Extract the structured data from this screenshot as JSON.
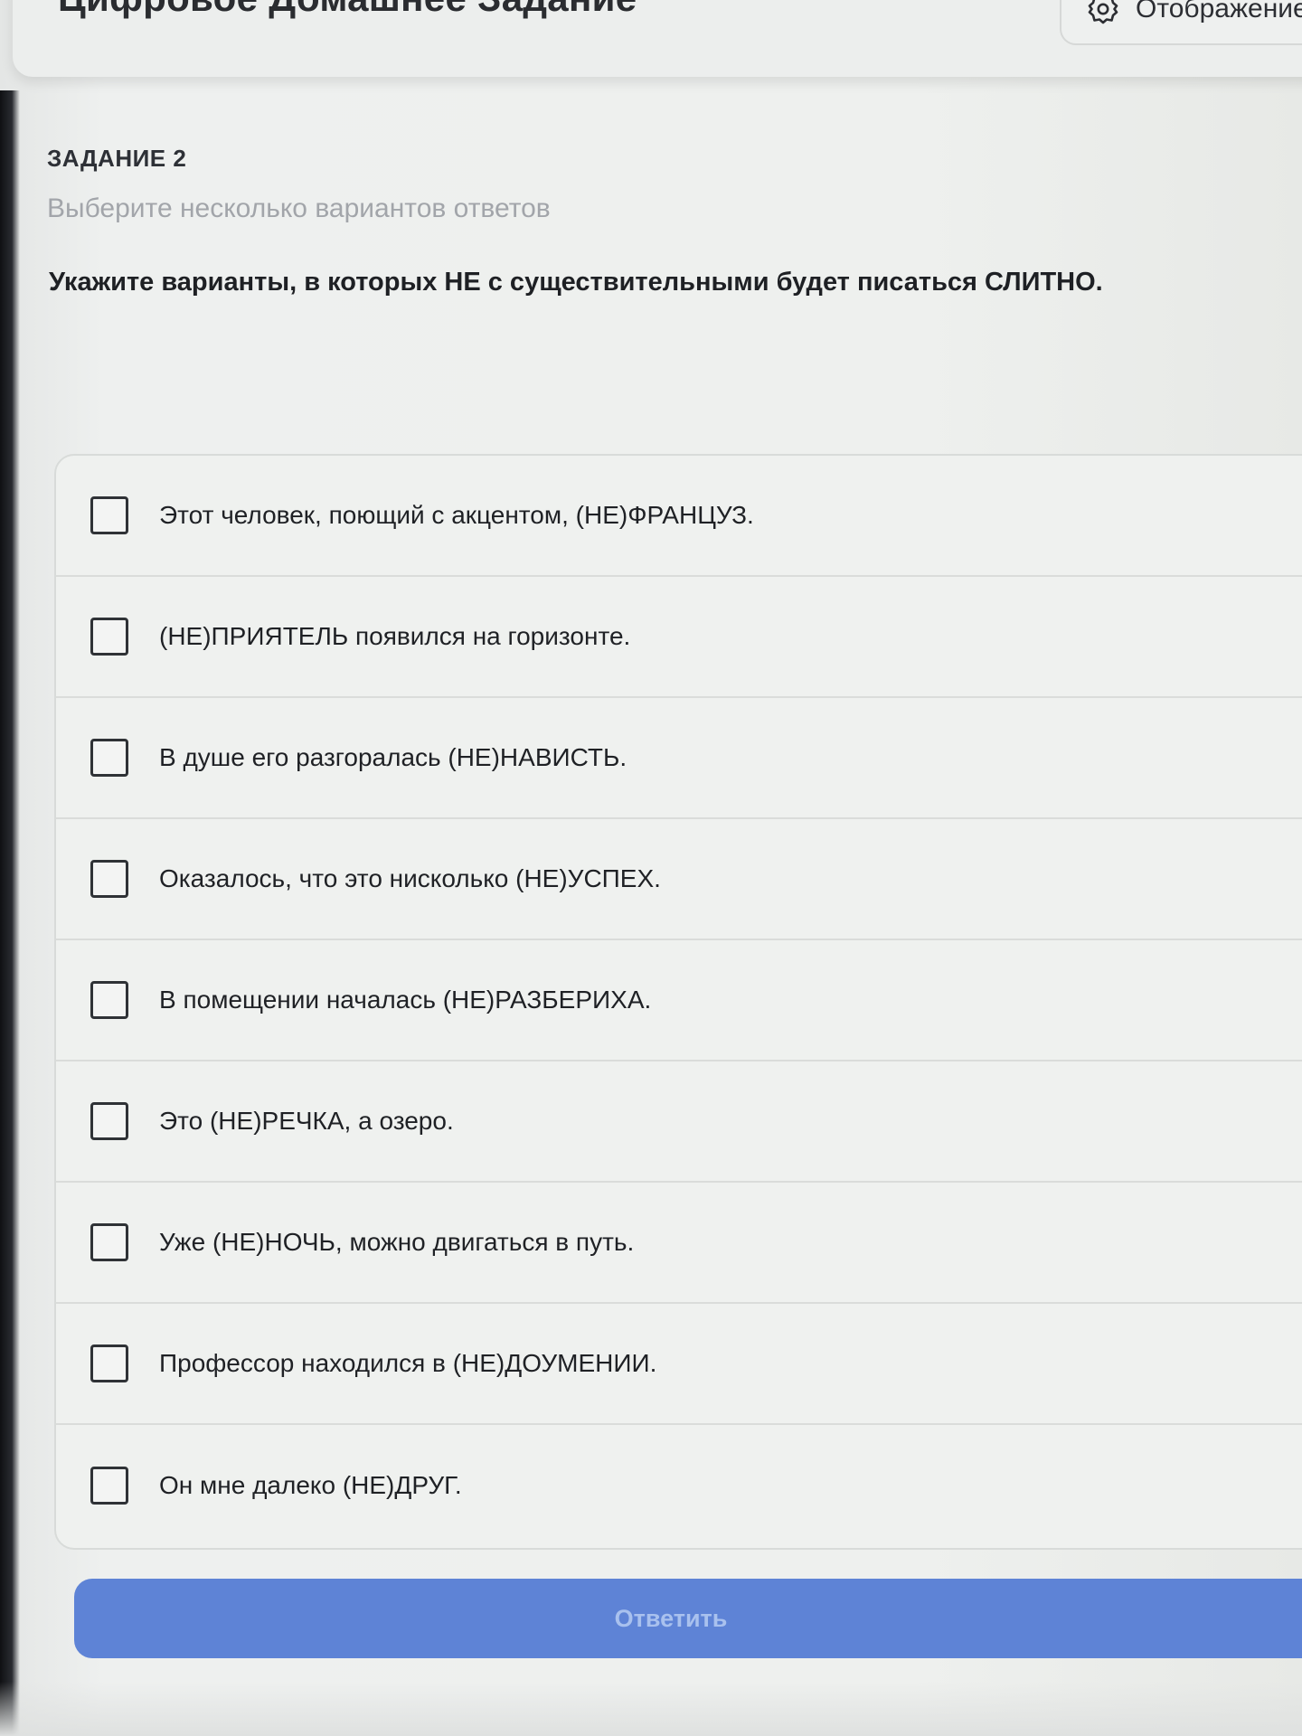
{
  "header": {
    "title": "Цифровое Домашнее Задание",
    "display_button": {
      "label": "Отображение",
      "icon": "gear-icon"
    }
  },
  "task": {
    "number": "ЗАДАНИЕ 2",
    "hint": "Выберите несколько вариантов ответов",
    "question": "Укажите варианты, в которых НЕ с существительными будет писаться СЛИТНО."
  },
  "options": [
    {
      "label": "Этот человек, поющий с акцентом, (НЕ)ФРАНЦУЗ.",
      "checked": false
    },
    {
      "label": "(НЕ)ПРИЯТЕЛЬ появился на горизонте.",
      "checked": false
    },
    {
      "label": "В душе его разгоралась (НЕ)НАВИСТЬ.",
      "checked": false
    },
    {
      "label": "Оказалось, что это нисколько (НЕ)УСПЕХ.",
      "checked": false
    },
    {
      "label": "В помещении началась (НЕ)РАЗБЕРИХА.",
      "checked": false
    },
    {
      "label": "Это (НЕ)РЕЧКА, а озеро.",
      "checked": false
    },
    {
      "label": "Уже (НЕ)НОЧЬ, можно двигаться в путь.",
      "checked": false
    },
    {
      "label": "Профессор находился в (НЕ)ДОУМЕНИИ.",
      "checked": false
    },
    {
      "label": "Он мне далеко (НЕ)ДРУГ.",
      "checked": false
    }
  ],
  "submit": {
    "label": "Ответить",
    "color": "#5e83d6"
  }
}
